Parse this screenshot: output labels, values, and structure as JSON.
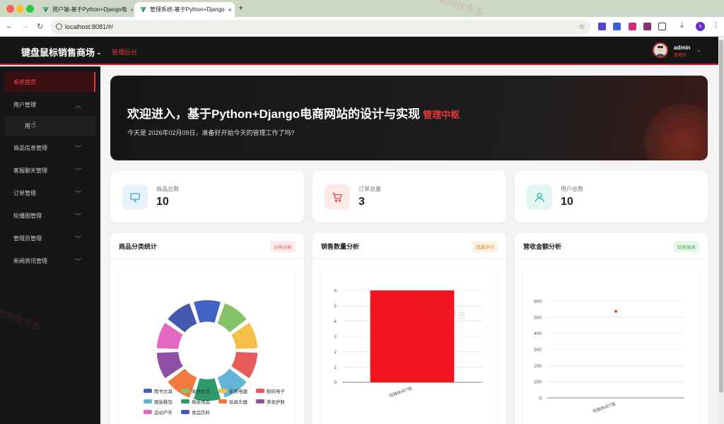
{
  "browser": {
    "tabs": [
      {
        "title": "用户端-基于Python+Django电",
        "close": "×"
      },
      {
        "title": "管理系统-基于Python+Django",
        "close": "×"
      }
    ],
    "new_tab": "+",
    "url": "localhost:8081/#/",
    "profile_initial": "x"
  },
  "header": {
    "title": "键盘鼠标销售商场 -",
    "subtitle": "管理后台",
    "user_name": "admin",
    "user_role": "管理员"
  },
  "sidebar": {
    "items": [
      {
        "label": "系统首页"
      },
      {
        "label": "用户管理"
      },
      {
        "label": "用"
      },
      {
        "label": "商品信息管理"
      },
      {
        "label": "客服聊天管理"
      },
      {
        "label": "订单管理"
      },
      {
        "label": "轮播图管理"
      },
      {
        "label": "管理员管理"
      },
      {
        "label": "新闻资讯管理"
      }
    ]
  },
  "banner": {
    "title": "欢迎进入，基于Python+Django电商网站的设计与实现",
    "tag": "管理中枢",
    "subtitle": "今天是 2026年02月09日，准备好开始今天的管理工作了吗?"
  },
  "stats": [
    {
      "label": "商品总数",
      "value": "10",
      "icon": "monitor-icon",
      "color": "#3a9bd5"
    },
    {
      "label": "订单总量",
      "value": "3",
      "icon": "cart-icon",
      "color": "#e04848"
    },
    {
      "label": "用户总数",
      "value": "10",
      "icon": "user-icon",
      "color": "#2ab3a6"
    }
  ],
  "cards": [
    {
      "title": "商品分类统计",
      "badge": "分布分析"
    },
    {
      "title": "销售数量分析",
      "badge": "销量排行"
    },
    {
      "title": "营收金额分析",
      "badge": "财务报表"
    }
  ],
  "watermark": "默网优务多",
  "chart_data": [
    {
      "type": "pie",
      "categories": [
        "图书文具",
        "家居生活",
        "家用电器",
        "数码电子",
        "服装鞋包",
        "母婴用品",
        "玩具乐器",
        "美妆护肤",
        "运动户外",
        "食品饮料"
      ],
      "values": [
        1,
        1,
        1,
        1,
        1,
        1,
        1,
        1,
        1,
        1
      ],
      "colors": [
        "#4263c4",
        "#86c266",
        "#f5c04a",
        "#e85a5a",
        "#62b5d6",
        "#2e9a6b",
        "#f27a3c",
        "#8e4fa6",
        "#e26ac2",
        "#4458b0"
      ]
    },
    {
      "type": "bar",
      "categories": [
        "阿楠休闲T恤"
      ],
      "values": [
        6
      ],
      "ylim": [
        0,
        6
      ],
      "yticks": [
        "0",
        "1",
        "2",
        "3",
        "4",
        "5",
        "6"
      ],
      "color": "#f0141e"
    },
    {
      "type": "scatter",
      "categories": [
        "阿楠休闲T恤"
      ],
      "values": [
        536
      ],
      "ylim": [
        0,
        600
      ],
      "yticks": [
        "0",
        "100",
        "200",
        "300",
        "400",
        "500",
        "600"
      ],
      "color": "#e53935"
    }
  ]
}
